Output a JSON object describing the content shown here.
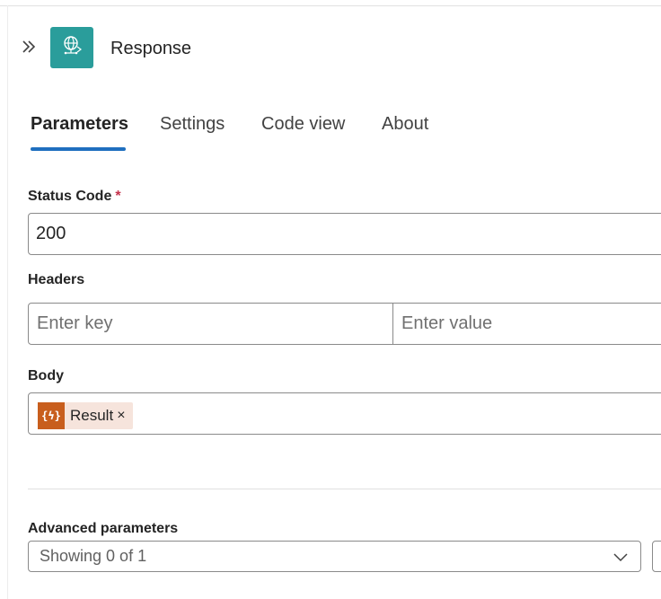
{
  "header": {
    "title": "Response",
    "expand_icon": "chevron-double-right-icon",
    "app_icon": "globe-http-icon",
    "tile_color": "#2a9d9b"
  },
  "tabs": [
    {
      "label": "Parameters",
      "active": true
    },
    {
      "label": "Settings",
      "active": false
    },
    {
      "label": "Code view",
      "active": false
    },
    {
      "label": "About",
      "active": false
    }
  ],
  "accent_color": "#1f6fbf",
  "status_code": {
    "label": "Status Code",
    "required_marker": "*",
    "value": "200"
  },
  "headers": {
    "label": "Headers",
    "key_placeholder": "Enter key",
    "value_placeholder": "Enter value"
  },
  "body": {
    "label": "Body",
    "token": {
      "icon_text": "{ϟ}",
      "icon": "expression-icon",
      "label": "Result",
      "remove_glyph": "×",
      "color": "#c85e1d"
    }
  },
  "advanced": {
    "label": "Advanced parameters",
    "dropdown_text": "Showing 0 of 1"
  }
}
